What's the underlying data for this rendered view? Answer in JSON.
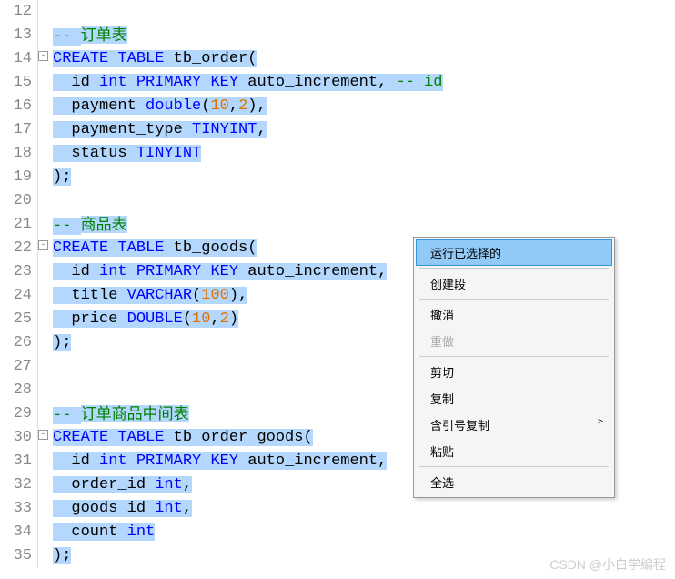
{
  "lines": [
    {
      "n": "12",
      "fold": false,
      "segs": []
    },
    {
      "n": "13",
      "fold": false,
      "segs": [
        {
          "t": "-- ",
          "c": "cm sel"
        },
        {
          "t": "订单表",
          "c": "cm cmcn sel"
        }
      ]
    },
    {
      "n": "14",
      "fold": true,
      "segs": [
        {
          "t": "CREATE",
          "c": "kw sel"
        },
        {
          "t": " ",
          "c": "sel"
        },
        {
          "t": "TABLE",
          "c": "kw sel"
        },
        {
          "t": " tb_order(",
          "c": "txt sel"
        }
      ]
    },
    {
      "n": "15",
      "fold": false,
      "segs": [
        {
          "t": "  id ",
          "c": "txt sel"
        },
        {
          "t": "int",
          "c": "kw sel"
        },
        {
          "t": " ",
          "c": "sel"
        },
        {
          "t": "PRIMARY",
          "c": "kw sel"
        },
        {
          "t": " ",
          "c": "sel"
        },
        {
          "t": "KEY",
          "c": "kw sel"
        },
        {
          "t": " auto_increment, ",
          "c": "txt sel"
        },
        {
          "t": "-- id",
          "c": "cm sel"
        }
      ]
    },
    {
      "n": "16",
      "fold": false,
      "segs": [
        {
          "t": "  payment ",
          "c": "txt sel"
        },
        {
          "t": "double",
          "c": "fn sel"
        },
        {
          "t": "(",
          "c": "txt sel"
        },
        {
          "t": "10",
          "c": "num sel"
        },
        {
          "t": ",",
          "c": "txt sel"
        },
        {
          "t": "2",
          "c": "num sel"
        },
        {
          "t": "),",
          "c": "txt sel"
        }
      ]
    },
    {
      "n": "17",
      "fold": false,
      "segs": [
        {
          "t": "  payment_type ",
          "c": "txt sel"
        },
        {
          "t": "TINYINT",
          "c": "kw sel"
        },
        {
          "t": ",",
          "c": "txt sel"
        }
      ]
    },
    {
      "n": "18",
      "fold": false,
      "segs": [
        {
          "t": "  status ",
          "c": "txt sel"
        },
        {
          "t": "TINYINT",
          "c": "kw sel"
        }
      ]
    },
    {
      "n": "19",
      "fold": false,
      "segs": [
        {
          "t": ");",
          "c": "txt sel"
        }
      ]
    },
    {
      "n": "20",
      "fold": false,
      "segs": []
    },
    {
      "n": "21",
      "fold": false,
      "segs": [
        {
          "t": "-- ",
          "c": "cm sel"
        },
        {
          "t": "商品表",
          "c": "cm cmcn sel"
        }
      ]
    },
    {
      "n": "22",
      "fold": true,
      "segs": [
        {
          "t": "CREATE",
          "c": "kw sel"
        },
        {
          "t": " ",
          "c": "sel"
        },
        {
          "t": "TABLE",
          "c": "kw sel"
        },
        {
          "t": " tb_goods(",
          "c": "txt sel"
        }
      ]
    },
    {
      "n": "23",
      "fold": false,
      "segs": [
        {
          "t": "  id ",
          "c": "txt sel"
        },
        {
          "t": "int",
          "c": "kw sel"
        },
        {
          "t": " ",
          "c": "sel"
        },
        {
          "t": "PRIMARY",
          "c": "kw sel"
        },
        {
          "t": " ",
          "c": "sel"
        },
        {
          "t": "KEY",
          "c": "kw sel"
        },
        {
          "t": " auto_increment,",
          "c": "txt sel"
        }
      ]
    },
    {
      "n": "24",
      "fold": false,
      "segs": [
        {
          "t": "  title ",
          "c": "txt sel"
        },
        {
          "t": "VARCHAR",
          "c": "fn sel"
        },
        {
          "t": "(",
          "c": "txt sel"
        },
        {
          "t": "100",
          "c": "num sel"
        },
        {
          "t": "),",
          "c": "txt sel"
        }
      ]
    },
    {
      "n": "25",
      "fold": false,
      "segs": [
        {
          "t": "  price ",
          "c": "txt sel"
        },
        {
          "t": "DOUBLE",
          "c": "fn sel"
        },
        {
          "t": "(",
          "c": "txt sel"
        },
        {
          "t": "10",
          "c": "num sel"
        },
        {
          "t": ",",
          "c": "txt sel"
        },
        {
          "t": "2",
          "c": "num sel"
        },
        {
          "t": ")",
          "c": "txt sel"
        }
      ]
    },
    {
      "n": "26",
      "fold": false,
      "segs": [
        {
          "t": ");",
          "c": "txt sel"
        }
      ]
    },
    {
      "n": "27",
      "fold": false,
      "segs": []
    },
    {
      "n": "28",
      "fold": false,
      "segs": []
    },
    {
      "n": "29",
      "fold": false,
      "segs": [
        {
          "t": "-- ",
          "c": "cm sel"
        },
        {
          "t": "订单商品中间表",
          "c": "cm cmcn sel"
        }
      ]
    },
    {
      "n": "30",
      "fold": true,
      "segs": [
        {
          "t": "CREATE",
          "c": "kw sel"
        },
        {
          "t": " ",
          "c": "sel"
        },
        {
          "t": "TABLE",
          "c": "kw sel"
        },
        {
          "t": " tb_order_goods(",
          "c": "txt sel"
        }
      ]
    },
    {
      "n": "31",
      "fold": false,
      "segs": [
        {
          "t": "  id ",
          "c": "txt sel"
        },
        {
          "t": "int",
          "c": "kw sel"
        },
        {
          "t": " ",
          "c": "sel"
        },
        {
          "t": "PRIMARY",
          "c": "kw sel"
        },
        {
          "t": " ",
          "c": "sel"
        },
        {
          "t": "KEY",
          "c": "kw sel"
        },
        {
          "t": " auto_increment,",
          "c": "txt sel"
        }
      ]
    },
    {
      "n": "32",
      "fold": false,
      "segs": [
        {
          "t": "  order_id ",
          "c": "txt sel"
        },
        {
          "t": "int",
          "c": "kw sel"
        },
        {
          "t": ",",
          "c": "txt sel"
        }
      ]
    },
    {
      "n": "33",
      "fold": false,
      "segs": [
        {
          "t": "  goods_id ",
          "c": "txt sel"
        },
        {
          "t": "int",
          "c": "kw sel"
        },
        {
          "t": ",",
          "c": "txt sel"
        }
      ]
    },
    {
      "n": "34",
      "fold": false,
      "segs": [
        {
          "t": "  count ",
          "c": "txt sel"
        },
        {
          "t": "int",
          "c": "kw sel"
        }
      ]
    },
    {
      "n": "35",
      "fold": false,
      "segs": [
        {
          "t": ");",
          "c": "txt sel"
        }
      ]
    }
  ],
  "menu": {
    "items": [
      {
        "label": "运行已选择的",
        "type": "hover"
      },
      {
        "type": "sep"
      },
      {
        "label": "创建段",
        "type": "item"
      },
      {
        "type": "sep"
      },
      {
        "label": "撤消",
        "type": "item"
      },
      {
        "label": "重做",
        "type": "disabled"
      },
      {
        "type": "sep"
      },
      {
        "label": "剪切",
        "type": "item"
      },
      {
        "label": "复制",
        "type": "item"
      },
      {
        "label": "含引号复制",
        "type": "sub"
      },
      {
        "label": "粘贴",
        "type": "item"
      },
      {
        "type": "sep"
      },
      {
        "label": "全选",
        "type": "item"
      }
    ]
  },
  "watermark": "CSDN @小白学编程",
  "fold_marker": "-",
  "submenu_arrow": ">"
}
